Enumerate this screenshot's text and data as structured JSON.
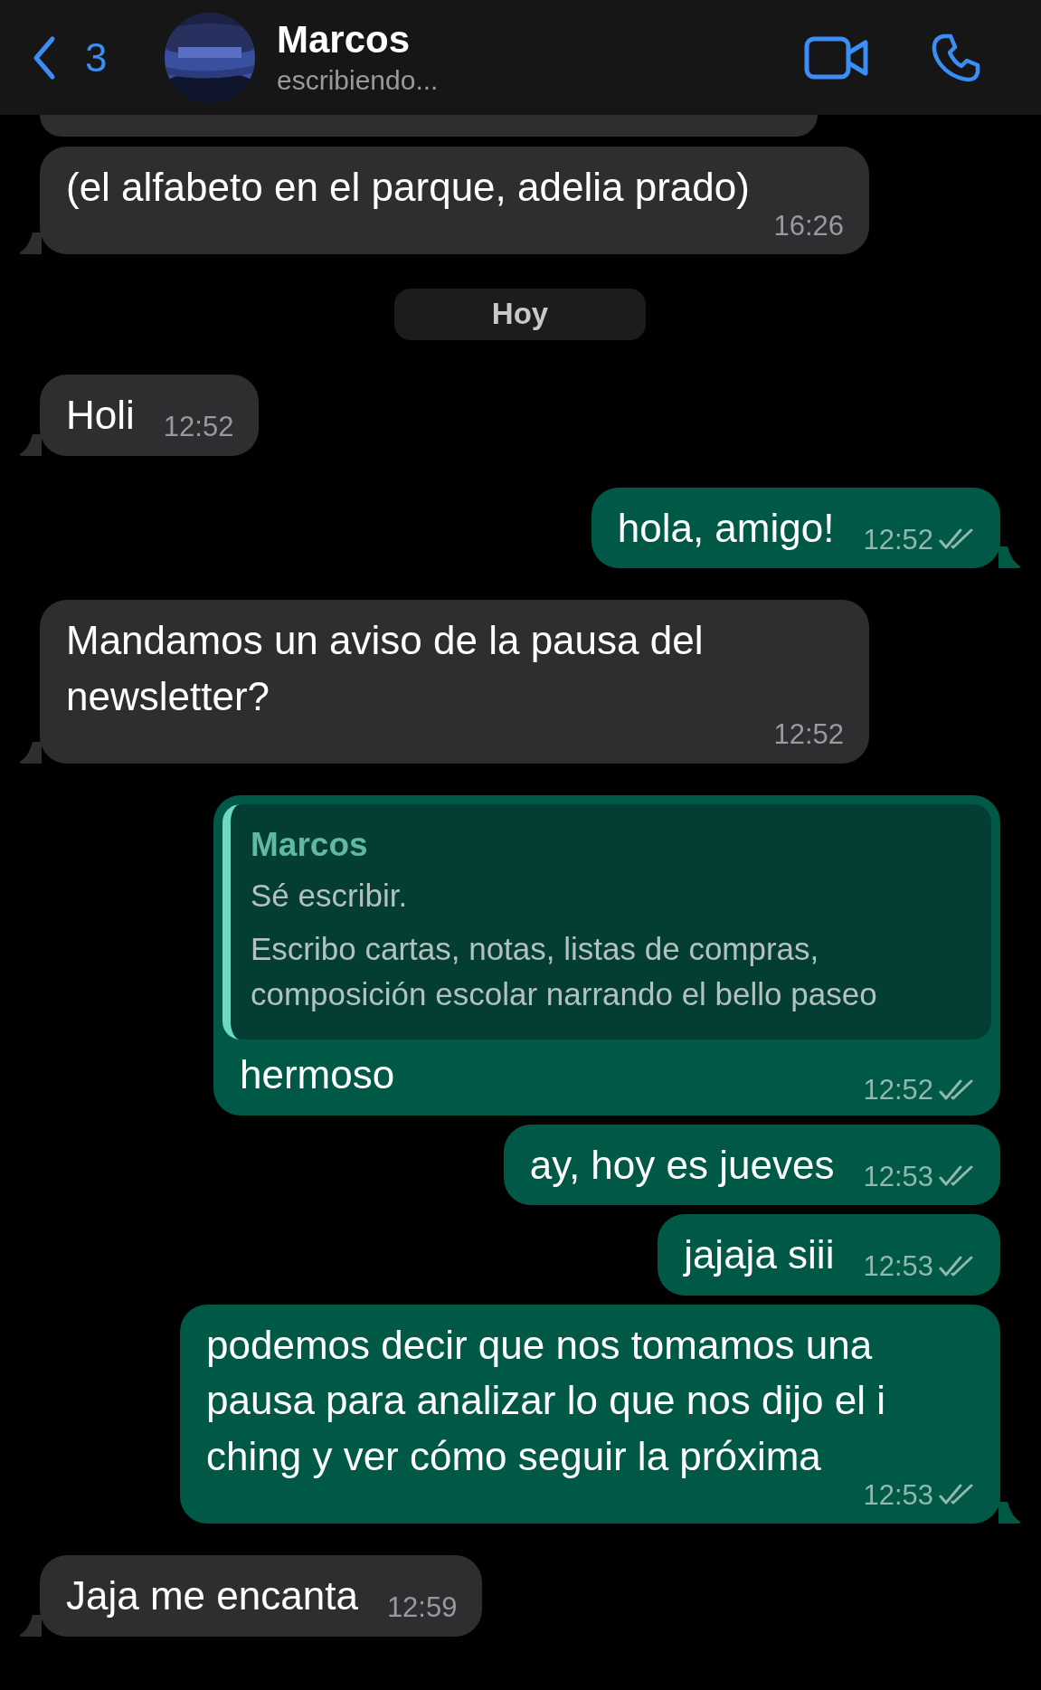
{
  "header": {
    "back_count": "3",
    "name": "Marcos",
    "status": "escribiendo..."
  },
  "messages": [
    {
      "kind": "cut",
      "outgoing": false
    },
    {
      "kind": "text",
      "outgoing": false,
      "text": "(el alfabeto en el parque, adelia prado)",
      "time": "16:26",
      "tail": true
    },
    {
      "kind": "date",
      "text": "Hoy"
    },
    {
      "kind": "text",
      "outgoing": false,
      "text": "Holi",
      "time": "12:52",
      "tail": true
    },
    {
      "kind": "text",
      "outgoing": true,
      "text": "hola, amigo!",
      "time": "12:52",
      "tail": true,
      "read": false
    },
    {
      "kind": "text",
      "outgoing": false,
      "text": "Mandamos un aviso de la pausa del newsletter?",
      "time": "12:52",
      "tail": true
    },
    {
      "kind": "reply",
      "outgoing": true,
      "quote": {
        "author": "Marcos",
        "lines": [
          "Sé escribir.",
          "Escribo cartas, notas, listas de compras, composición escolar narrando el bello paseo"
        ]
      },
      "text": "hermoso",
      "time": "12:52",
      "tail": false,
      "read": false
    },
    {
      "kind": "text",
      "outgoing": true,
      "text": "ay, hoy es jueves",
      "time": "12:53",
      "tail": false,
      "read": false
    },
    {
      "kind": "text",
      "outgoing": true,
      "text": "jajaja siii",
      "time": "12:53",
      "tail": false,
      "read": false
    },
    {
      "kind": "text",
      "outgoing": true,
      "text": "podemos decir que nos tomamos una pausa para analizar lo que nos dijo el i ching y ver cómo seguir la próxima",
      "time": "12:53",
      "tail": true,
      "read": false
    },
    {
      "kind": "text",
      "outgoing": false,
      "text": "Jaja me encanta",
      "time": "12:59",
      "tail": true
    }
  ]
}
